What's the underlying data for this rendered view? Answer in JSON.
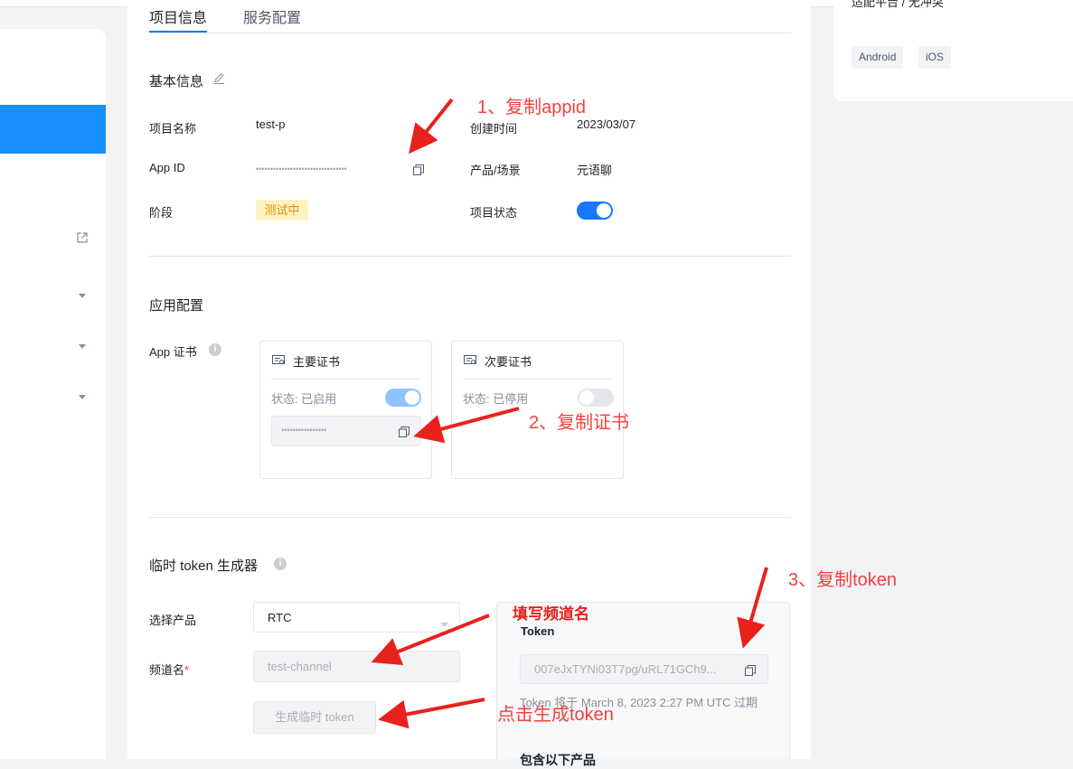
{
  "tabs": [
    {
      "label": "项目信息",
      "active": true
    },
    {
      "label": "服务配置",
      "active": false
    }
  ],
  "right_card": {
    "truncated_heading": "适配平台 / 无冲突",
    "platforms": [
      "Android",
      "iOS"
    ]
  },
  "basic_info": {
    "title": "基本信息",
    "project_name_label": "项目名称",
    "project_name_value": "test-p",
    "app_id_label": "App ID",
    "app_id_masked": "••••••••••••••••••••••••••••••••",
    "stage_label": "阶段",
    "stage_badge": "测试中",
    "created_label": "创建时间",
    "created_value": "2023/03/07",
    "product_label": "产品/场景",
    "product_value": "元语聊",
    "status_label": "项目状态",
    "status_on": true
  },
  "app_config": {
    "title": "应用配置",
    "cert_label": "App 证书",
    "primary": {
      "title": "主要证书",
      "status": "状态: 已启用",
      "enabled": true,
      "masked": "••••••••••••••••"
    },
    "secondary": {
      "title": "次要证书",
      "status": "状态: 已停用",
      "enabled": false
    }
  },
  "token_gen": {
    "title": "临时 token 生成器",
    "product_label": "选择产品",
    "product_value": "RTC",
    "channel_label": "频道名",
    "required_mark": "*",
    "channel_value": "test-channel",
    "generate_button": "生成临时 token",
    "token_title": "Token",
    "token_value": "007eJxTYNi03T7pg/uRL71GCh9...",
    "expiry_text": "Token 将于 March 8, 2023 2:27 PM UTC 过期",
    "includes_heading": "包含以下产品"
  },
  "annotations": {
    "step1": "1、复制appid",
    "step2": "2、复制证书",
    "step3": "3、复制token",
    "fill_channel": "填写频道名",
    "click_generate": "点击生成token"
  },
  "colors": {
    "primary": "#1677ff",
    "sidebar_active": "#1890ff",
    "annotation_red": "#f53f3f",
    "badge_bg": "#fff3c2",
    "badge_text": "#e38f00"
  }
}
